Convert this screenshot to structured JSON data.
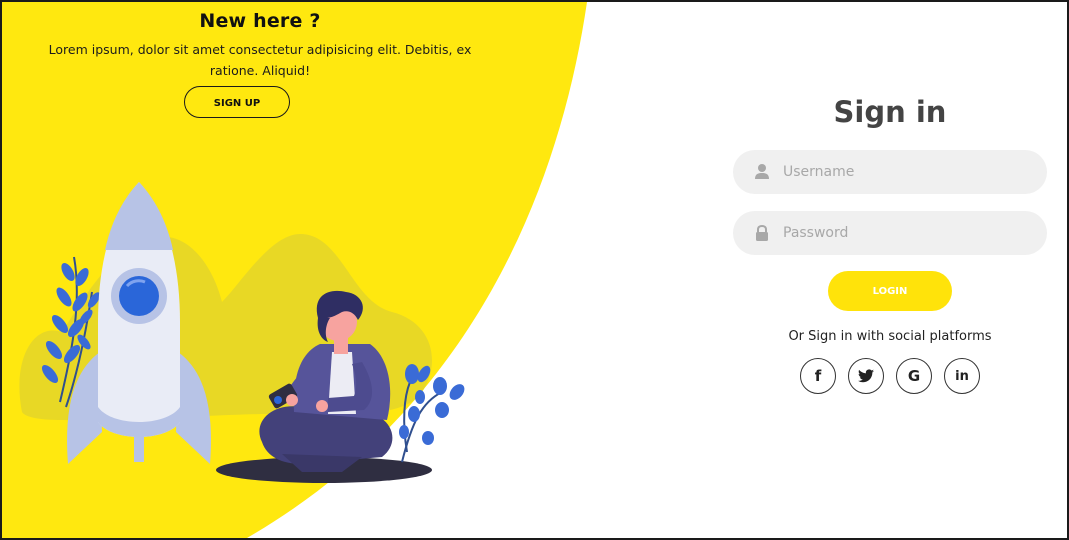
{
  "left": {
    "title": "New here ?",
    "text": "Lorem ipsum, dolor sit amet consectetur adipisicing elit. Debitis, ex ratione. Aliquid!",
    "signup_label": "SIGN UP"
  },
  "signin": {
    "title": "Sign in",
    "username_placeholder": "Username",
    "password_placeholder": "Password",
    "login_label": "LOGIN",
    "social_text": "Or Sign in with social platforms",
    "social": [
      {
        "name": "facebook",
        "glyph": "f"
      },
      {
        "name": "twitter",
        "glyph": "t"
      },
      {
        "name": "google",
        "glyph": "G"
      },
      {
        "name": "linkedin",
        "glyph": "in"
      }
    ]
  },
  "colors": {
    "accent_yellow": "#ffe80f",
    "login_yellow": "#ffe30a",
    "input_bg": "#f0f0f0",
    "title_gray": "#444444"
  },
  "icons": [
    "user-icon",
    "lock-icon",
    "facebook-icon",
    "twitter-icon",
    "google-icon",
    "linkedin-icon"
  ]
}
